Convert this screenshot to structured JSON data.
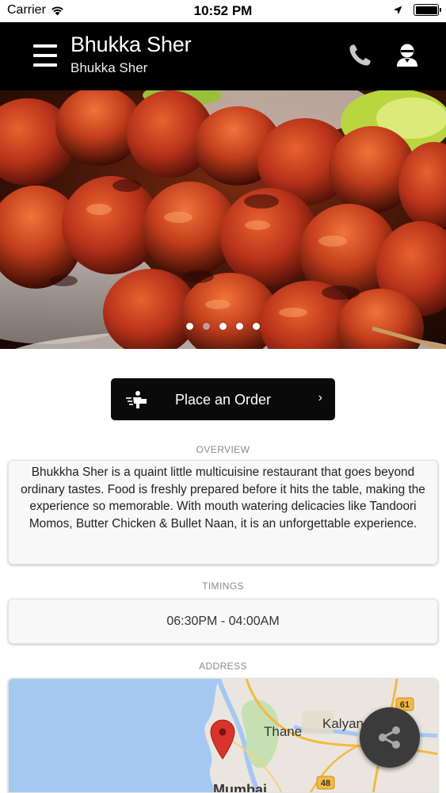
{
  "status_bar": {
    "carrier": "Carrier",
    "time": "10:52 PM"
  },
  "app_bar": {
    "title": "Bhukka Sher",
    "subtitle": "Bhukka Sher",
    "icons": [
      "menu-icon",
      "phone-icon",
      "account-icon"
    ]
  },
  "hero": {
    "slide_count": 5,
    "active_slide": 1
  },
  "order_button": {
    "label": "Place an Order",
    "chevron": "›",
    "icon": "delivery-icon"
  },
  "overview": {
    "label": "OVERVIEW",
    "text": "Bhukkha Sher is a quaint little multicuisine restaurant that goes beyond ordinary tastes. Food is freshly prepared before it hits the table, making the experience so memorable. With mouth watering delicacies like Tandoori Momos, Butter Chicken & Bullet Naan, it is an unforgettable experience."
  },
  "timings": {
    "label": "TIMINGS",
    "value": "06:30PM - 04:00AM"
  },
  "address": {
    "label": "ADDRESS",
    "map_labels": {
      "thane": "Thane",
      "kalyan": "Kalyan",
      "mumbai": "Mumbai",
      "road_61": "61",
      "road_48": "48"
    }
  },
  "colors": {
    "app_bar": "#000000",
    "order_button": "#0a0a0a",
    "share_fab": "#3b3b3b",
    "map_pin": "#d9342b"
  }
}
